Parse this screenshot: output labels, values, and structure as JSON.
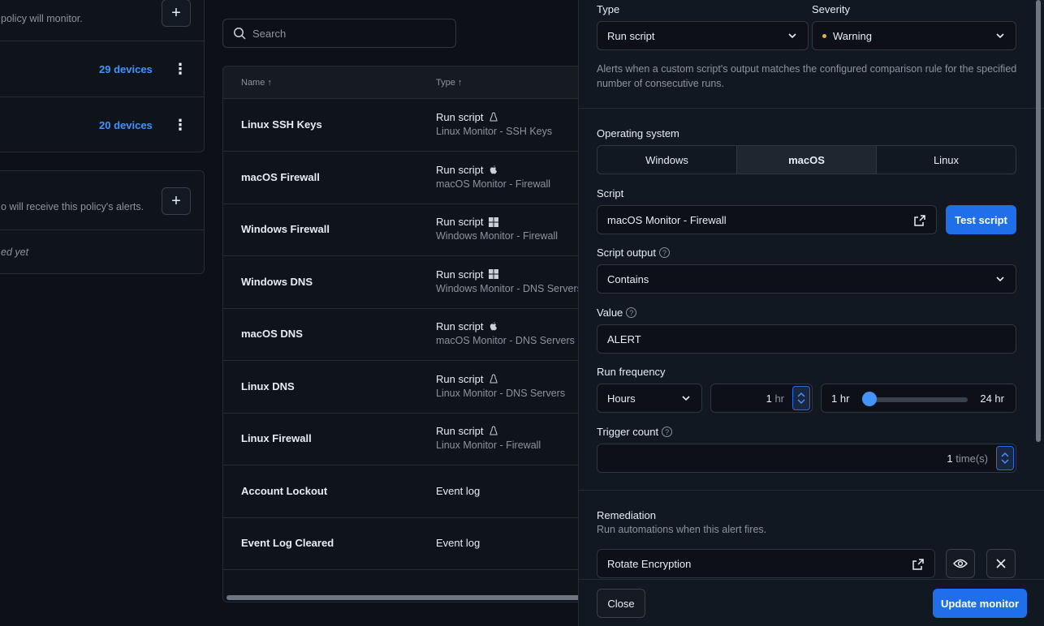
{
  "left": {
    "card1_desc": "policy will monitor.",
    "rows": [
      {
        "devices": "29 devices"
      },
      {
        "devices": "20 devices"
      }
    ],
    "card2_desc": "o will receive this policy's alerts.",
    "card2_empty": "ed yet"
  },
  "search": {
    "placeholder": "Search"
  },
  "table": {
    "headers": {
      "name": "Name",
      "type": "Type"
    },
    "rows": [
      {
        "name": "Linux SSH Keys",
        "type": "Run script",
        "os_icon": "linux-icon",
        "script": "Linux Monitor - SSH Keys"
      },
      {
        "name": "macOS Firewall",
        "type": "Run script",
        "os_icon": "apple-icon",
        "script": "macOS Monitor - Firewall"
      },
      {
        "name": "Windows Firewall",
        "type": "Run script",
        "os_icon": "windows-icon",
        "script": "Windows Monitor - Firewall"
      },
      {
        "name": "Windows DNS",
        "type": "Run script",
        "os_icon": "windows-icon",
        "script": "Windows Monitor - DNS Servers"
      },
      {
        "name": "macOS DNS",
        "type": "Run script",
        "os_icon": "apple-icon",
        "script": "macOS Monitor - DNS Servers"
      },
      {
        "name": "Linux DNS",
        "type": "Run script",
        "os_icon": "linux-icon",
        "script": "Linux Monitor - DNS Servers"
      },
      {
        "name": "Linux Firewall",
        "type": "Run script",
        "os_icon": "linux-icon",
        "script": "Linux Monitor - Firewall"
      },
      {
        "name": "Account Lockout",
        "type": "Event log",
        "os_icon": "",
        "script": ""
      },
      {
        "name": "Event Log Cleared",
        "type": "Event log",
        "os_icon": "",
        "script": ""
      }
    ]
  },
  "drawer": {
    "type_label": "Type",
    "type_value": "Run script",
    "severity_label": "Severity",
    "severity_value": "Warning",
    "severity_color": "#e3b341",
    "description": "Alerts when a custom script's output matches the configured comparison rule for the specified number of consecutive runs.",
    "os_label": "Operating system",
    "os_options": [
      "Windows",
      "macOS",
      "Linux"
    ],
    "os_selected": "macOS",
    "script_label": "Script",
    "script_value": "macOS Monitor - Firewall",
    "test_script": "Test script",
    "output_label": "Script output",
    "output_value": "Contains",
    "value_label": "Value",
    "value_value": "ALERT",
    "freq_label": "Run frequency",
    "freq_unit": "Hours",
    "freq_amount": "1",
    "freq_amount_unit": "hr",
    "slider_min": "1 hr",
    "slider_max": "24 hr",
    "trigger_label": "Trigger count",
    "trigger_value": "1",
    "trigger_unit": "time(s)",
    "remediation_title": "Remediation",
    "remediation_desc": "Run automations when this alert fires.",
    "remediation_item": "Rotate Encryption",
    "close": "Close",
    "update": "Update monitor"
  }
}
